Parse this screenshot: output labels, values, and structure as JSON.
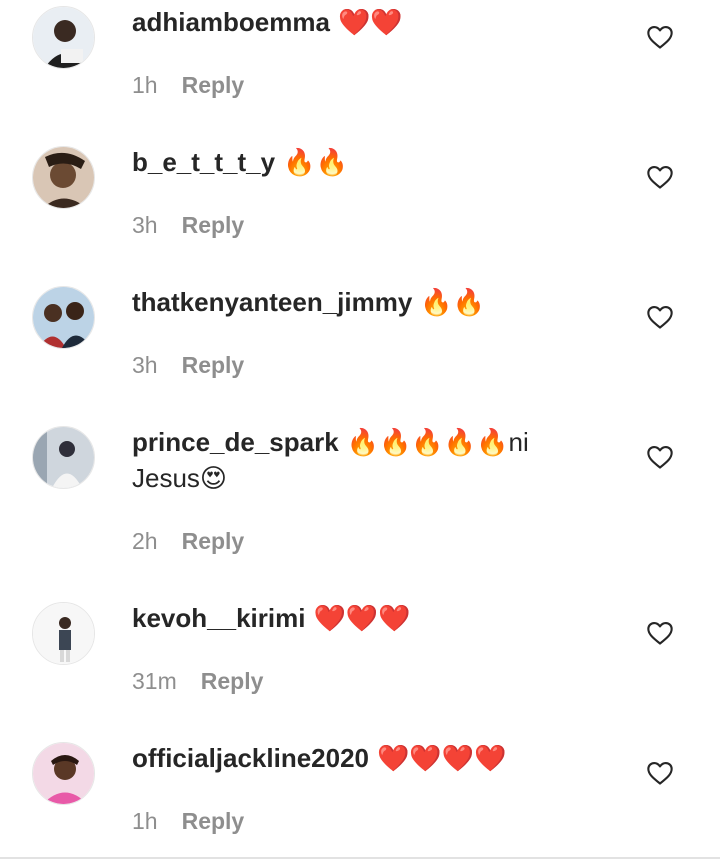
{
  "reply_label": "Reply",
  "comments": [
    {
      "username": "adhiamboemma",
      "text": "❤️❤️",
      "time": "1h"
    },
    {
      "username": "b_e_t_t_t_y",
      "text": "🔥🔥",
      "time": "3h"
    },
    {
      "username": "thatkenyanteen_jimmy",
      "text": "🔥🔥",
      "time": "3h"
    },
    {
      "username": "prince_de_spark",
      "text": "🔥🔥🔥🔥🔥ni Jesus😍",
      "time": "2h"
    },
    {
      "username": "kevoh__kirimi",
      "text": "❤️❤️❤️",
      "time": "31m"
    },
    {
      "username": "officialjackline2020",
      "text": "❤️❤️❤️❤️",
      "time": "1h"
    }
  ],
  "icons": {
    "like": "heart-outline-icon",
    "avatar": "user-avatar"
  },
  "colors": {
    "username": "#262626",
    "meta": "#8e8e8e",
    "heart_outline": "#262626"
  }
}
